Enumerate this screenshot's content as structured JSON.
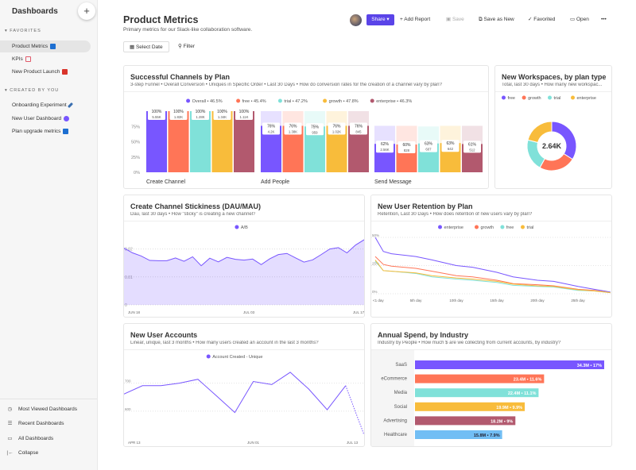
{
  "sidebar": {
    "title": "Dashboards",
    "add_label": "+",
    "favorites_label": "FAVORITES",
    "favorites": [
      {
        "label": "Product Metrics",
        "emoji_color": "#1d6fd1"
      },
      {
        "label": "KPIs",
        "emoji_color": "#e05a6a"
      },
      {
        "label": "New Product Launch",
        "emoji_color": "#d9342b"
      }
    ],
    "created_label": "CREATED BY YOU",
    "created": [
      {
        "label": "Onboarding Experiment",
        "emoji_color": "#3a6fb0"
      },
      {
        "label": "New User Dashboard",
        "emoji_color": "#7856ff"
      },
      {
        "label": "Plan upgrade metrics",
        "emoji_color": "#1d6fd1"
      }
    ],
    "bottom": [
      {
        "label": "Most Viewed Dashboards",
        "icon": "clock-icon"
      },
      {
        "label": "Recent Dashboards",
        "icon": "list-icon"
      },
      {
        "label": "All Dashboards",
        "icon": "folder-icon"
      },
      {
        "label": "Collapse",
        "icon": "collapse-icon"
      }
    ]
  },
  "header": {
    "title": "Product Metrics",
    "description": "Primary metrics for our Slack-like collaboration software.",
    "share": "Share ▾",
    "add_report": "Add Report",
    "save": "Save",
    "save_as_new": "Save as New",
    "favorited": "Favorited",
    "open": "Open",
    "more": "•••"
  },
  "filters": {
    "select_date": "Select Date",
    "filter": "Filter"
  },
  "colors": {
    "purple": "#7856ff",
    "red": "#ff7557",
    "teal": "#80e1d9",
    "yellow": "#f8bc3b",
    "maroon": "#b2596e",
    "blue": "#72bef4"
  },
  "chart_data": [
    {
      "type": "bar",
      "title": "Successful Channels by Plan",
      "subtitle": "3-step Funnel • Overall Conversion • Uniques in Specific Order • Last 30 Days • How do conversion rates for the creation of a channel vary by plan?",
      "legend": [
        "Overall • 46.5%",
        "free • 45.4%",
        "trial • 47.2%",
        "growth • 47.8%",
        "enterprise • 46.3%"
      ],
      "categories": [
        "Create Channel",
        "Add People",
        "Send Message"
      ],
      "yticks": [
        "0%",
        "25%",
        "50%",
        "75%"
      ],
      "ylim": [
        0,
        100
      ],
      "series": [
        {
          "name": "Overall",
          "values": [
            100,
            76,
            46.5
          ],
          "labels": [
            "100%",
            "76%",
            "62%"
          ],
          "counts": [
            "5.55K",
            "4.2K",
            "2.56K"
          ]
        },
        {
          "name": "free",
          "values": [
            100,
            76,
            45.4
          ],
          "labels": [
            "100%",
            "76%",
            "60%"
          ],
          "counts": [
            "1.82K",
            "1.38K",
            "828"
          ]
        },
        {
          "name": "trial",
          "values": [
            100,
            75,
            47.2
          ],
          "labels": [
            "100%",
            "75%",
            "63%"
          ],
          "counts": [
            "1.28K",
            "959",
            "607"
          ]
        },
        {
          "name": "growth",
          "values": [
            100,
            76,
            47.8
          ],
          "labels": [
            "100%",
            "76%",
            "63%"
          ],
          "counts": [
            "1.34K",
            "1.02K",
            "642"
          ]
        },
        {
          "name": "enterprise",
          "values": [
            100,
            76,
            46.3
          ],
          "labels": [
            "100%",
            "76%",
            "61%"
          ],
          "counts": [
            "1.11K",
            "845",
            "512"
          ]
        }
      ]
    },
    {
      "type": "pie",
      "title": "New Workspaces, by plan type",
      "subtitle": "Total, last 30 days • How many new workspac...",
      "total": "2.64K",
      "legend": [
        "free",
        "growth",
        "trial",
        "enterprise"
      ],
      "values": [
        0.34,
        0.24,
        0.21,
        0.21
      ]
    },
    {
      "type": "area",
      "title": "Create Channel Stickiness (DAU/MAU)",
      "subtitle": "Dau, last 30 days • How \"sticky\" is creating a new channel?",
      "legend": [
        "A/B"
      ],
      "yticks": [
        "0",
        "0.01",
        "0.02"
      ],
      "ylim": [
        0,
        0.025
      ],
      "xticks": [
        "JUN 18",
        "JUL 03",
        "JUL 17"
      ],
      "values": [
        0.0203,
        0.0186,
        0.0175,
        0.0159,
        0.0158,
        0.0158,
        0.0168,
        0.0156,
        0.0172,
        0.014,
        0.0167,
        0.0154,
        0.017,
        0.0163,
        0.016,
        0.0164,
        0.0144,
        0.0165,
        0.018,
        0.0184,
        0.0168,
        0.0153,
        0.0161,
        0.018,
        0.02,
        0.0205,
        0.0186,
        0.0214,
        0.0233
      ]
    },
    {
      "type": "line",
      "title": "New User Retention by Plan",
      "subtitle": "Retention, Last 30 Days • How does retention of new users vary by plan?",
      "legend": [
        "enterprise",
        "growth",
        "free",
        "trial"
      ],
      "yticks": [
        "0%",
        "25%",
        "50%"
      ],
      "ylim": [
        0,
        50
      ],
      "xticks": [
        "<1 day",
        "5th day",
        "10th day",
        "15th day",
        "20th day",
        "25th day"
      ],
      "x": [
        0,
        1,
        2,
        5,
        7,
        10,
        12,
        15,
        17,
        20,
        22,
        25,
        27,
        29
      ],
      "series": [
        {
          "name": "enterprise",
          "values": [
            50,
            37.5,
            35.5,
            33,
            30,
            25,
            23.5,
            19,
            15,
            12,
            11,
            6.5,
            4,
            1.5
          ]
        },
        {
          "name": "growth",
          "values": [
            33,
            26,
            24.5,
            22.5,
            20,
            16,
            15,
            12,
            9,
            8,
            7,
            4,
            3,
            1
          ]
        },
        {
          "name": "free",
          "values": [
            29,
            20.5,
            20,
            18,
            15,
            13,
            12,
            10,
            7.5,
            6.5,
            6,
            3,
            2.5,
            1
          ]
        },
        {
          "name": "trial",
          "values": [
            30,
            20.5,
            20,
            18.5,
            16,
            14,
            13,
            11,
            8.5,
            7,
            6.5,
            3.5,
            2.5,
            1
          ]
        }
      ]
    },
    {
      "type": "line",
      "title": "New User Accounts",
      "subtitle": "Linear, unique, last 3 months • How many users created an account in the last 3 months?",
      "legend": [
        "Account Created - Unique"
      ],
      "yticks": [
        "600",
        "700"
      ],
      "ylim": [
        500,
        770
      ],
      "xticks": [
        "APR 13",
        "JUN 01",
        "JUL 13"
      ],
      "values": [
        661,
        691,
        691,
        700,
        714,
        655,
        595,
        706,
        695,
        739,
        679,
        605,
        691,
        515
      ]
    },
    {
      "type": "bar",
      "title": "Annual Spend, by Industry",
      "subtitle": "Industry by People • How much $ are we collecting from current accounts, by industry?",
      "categories": [
        "SaaS",
        "eCommerce",
        "Media",
        "Social",
        "Advertising",
        "Healthcare"
      ],
      "values": [
        34.3,
        23.4,
        22.4,
        19.9,
        18.2,
        15.8
      ],
      "labels": [
        "34.3M • 17%",
        "23.4M • 11.6%",
        "22.4M • 11.1%",
        "19.9M • 9.9%",
        "18.2M • 9%",
        "15.8M • 7.9%"
      ]
    }
  ]
}
